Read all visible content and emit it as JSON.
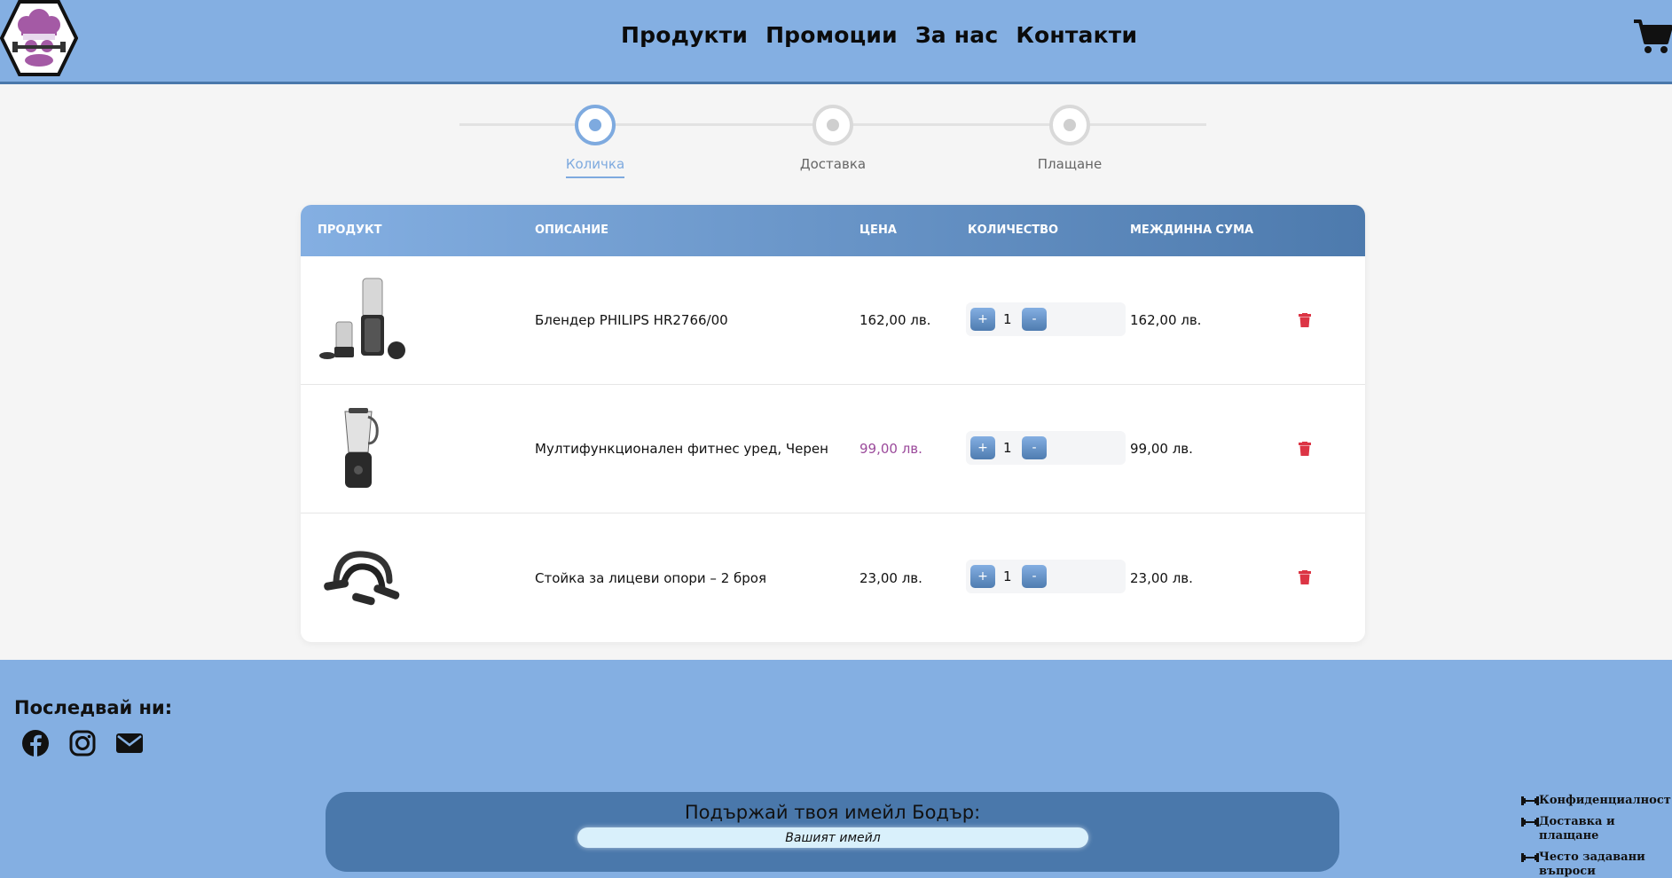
{
  "header": {
    "logo_alt": "Бодър",
    "nav": [
      {
        "label": "Продукти"
      },
      {
        "label": "Промоции"
      },
      {
        "label": "За нас"
      },
      {
        "label": "Контакти"
      }
    ]
  },
  "steps": [
    {
      "label": "Количка",
      "active": true
    },
    {
      "label": "Доставка",
      "active": false
    },
    {
      "label": "Плащане",
      "active": false
    }
  ],
  "table": {
    "headers": {
      "product": "ПРОДУКТ",
      "description": "ОПИСАНИЕ",
      "price": "ЦЕНА",
      "quantity": "КОЛИЧЕСТВО",
      "subtotal": "МЕЖДИННА СУМА"
    },
    "plus_label": "+",
    "minus_label": "-",
    "rows": [
      {
        "description": "Блендер PHILIPS HR2766/00",
        "price": "162,00 лв.",
        "quantity": "1",
        "subtotal": "162,00 лв.",
        "price_highlight": false
      },
      {
        "description": "Мултифункционален фитнес уред, Черен",
        "price": "99,00 лв.",
        "quantity": "1",
        "subtotal": "99,00 лв.",
        "price_highlight": true
      },
      {
        "description": "Стойка за лицеви опори – 2 броя",
        "price": "23,00 лв.",
        "quantity": "1",
        "subtotal": "23,00 лв.",
        "price_highlight": false
      }
    ]
  },
  "footer": {
    "follow_title": "Последвай ни:",
    "socials": [
      "facebook-icon",
      "instagram-icon",
      "email-icon"
    ],
    "newsletter_title": "Подържай твоя имейл Бодър:",
    "newsletter_placeholder": "Вашият имейл",
    "links": [
      {
        "label": "Конфиденциалност"
      },
      {
        "label": "Доставка и плащане"
      },
      {
        "label": "Често задавани въпроси"
      }
    ]
  },
  "colors": {
    "header_bg": "#84afe2",
    "accent": "#7eaadf",
    "dark_blue": "#4a78ab",
    "delete_red": "#dc3545",
    "price_highlight": "#9b4a9b"
  }
}
